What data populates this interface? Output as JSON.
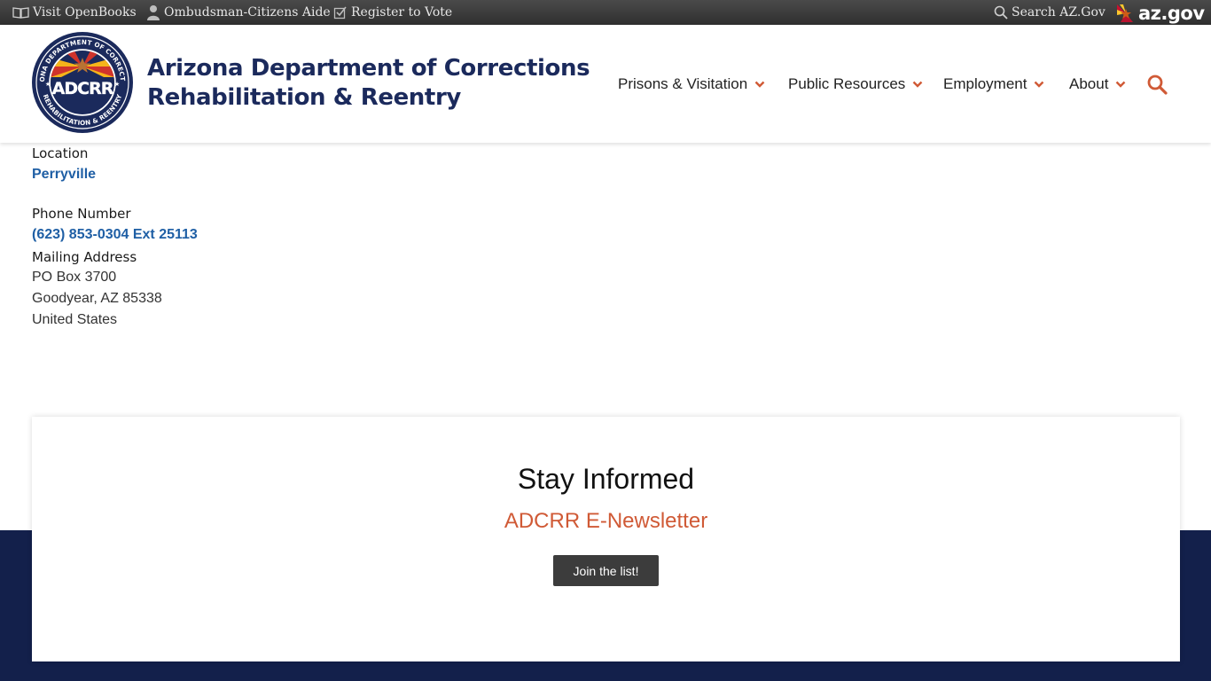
{
  "topbar": {
    "links": [
      {
        "label": "Visit OpenBooks",
        "icon": "book-icon"
      },
      {
        "label": "Ombudsman-Citizens Aide",
        "icon": "person-icon"
      },
      {
        "label": "Register to Vote",
        "icon": "checkbox-icon"
      }
    ],
    "search_label": "Search AZ.Gov",
    "azgov_logo": "az.gov"
  },
  "header": {
    "seal": {
      "initials": "ADCRR",
      "ring_top": "ARIZONA DEPARTMENT OF CORRECTIONS",
      "ring_bottom": "REHABILITATION & REENTRY"
    },
    "org_name_line1": "Arizona Department of Corrections",
    "org_name_line2": "Rehabilitation & Reentry",
    "nav": [
      {
        "label": "Prisons & Visitation"
      },
      {
        "label": "Public Resources"
      },
      {
        "label": "Employment"
      },
      {
        "label": "About"
      }
    ]
  },
  "contact": {
    "location_label": "Location",
    "location_value": "Perryville",
    "phone_label": "Phone Number",
    "phone_value": "(623) 853-0304 Ext 25113",
    "mailing_label": "Mailing Address",
    "address_line1": "PO Box 3700",
    "address_line2": "Goodyear, AZ 85338",
    "address_line3": "United States"
  },
  "newsletter": {
    "title": "Stay Informed",
    "subtitle": "ADCRR E-Newsletter",
    "button_label": "Join the list!"
  },
  "colors": {
    "navy": "#13204b",
    "brand_text": "#1b2a5c",
    "accent_orange": "#d05a36",
    "link_blue": "#1f5fa5"
  }
}
